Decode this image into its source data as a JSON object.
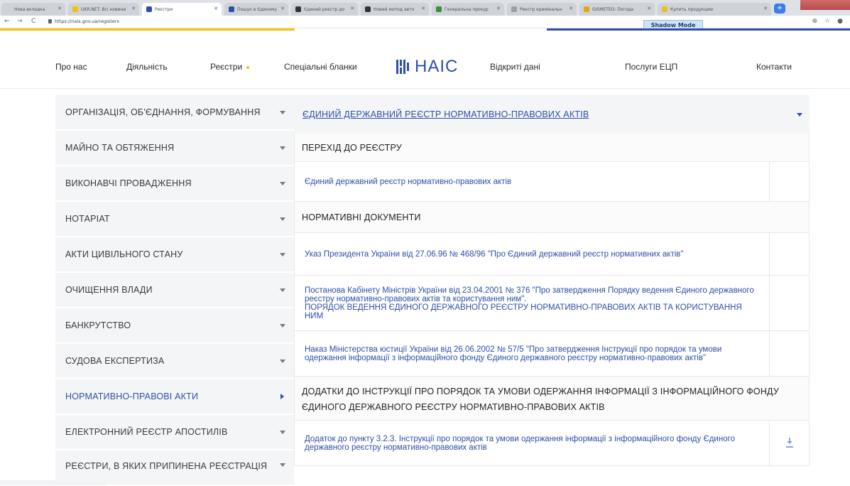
{
  "browser": {
    "tabs": [
      {
        "label": "Нова вкладка",
        "favicon_color": "#cfd3d9"
      },
      {
        "label": "UKR.NET: Всі новини",
        "favicon_color": "#f3c10a"
      },
      {
        "label": "Реєстри",
        "favicon_color": "#2e4fa8"
      },
      {
        "label": "Пошук в Єдиному",
        "favicon_color": "#2e4fa8"
      },
      {
        "label": "Єдиний реєстр до",
        "favicon_color": "#333333"
      },
      {
        "label": "Новий метод авто",
        "favicon_color": "#333333"
      },
      {
        "label": "Генеральна прокур",
        "favicon_color": "#3a8f3a"
      },
      {
        "label": "Реєстр кримінальн",
        "favicon_color": "#9aa0a6"
      },
      {
        "label": "GISMETEO: Погода",
        "favicon_color": "#e8a21b"
      },
      {
        "label": "Купить продукцию",
        "favicon_color": "#e8c21b"
      }
    ],
    "url": "https://nais.gov.ua/registers",
    "shadow_mode": "Shadow Mode",
    "accent_yellow": "#f3c10a",
    "accent_blue": "#2e4fa8"
  },
  "header": {
    "nav_left": [
      "Про нас",
      "Діяльність",
      "Реєстри",
      "Спеціальні бланки"
    ],
    "logo_text": "НАІС",
    "nav_right": [
      "Відкриті дані",
      "Послуги ЕЦП",
      "Контакти"
    ]
  },
  "sidebar": {
    "items": [
      {
        "label": "ОРГАНІЗАЦІЯ, ОБ'ЄДНАННЯ, ФОРМУВАННЯ"
      },
      {
        "label": "МАЙНО ТА ОБТЯЖЕННЯ"
      },
      {
        "label": "ВИКОНАВЧІ ПРОВАДЖЕННЯ"
      },
      {
        "label": "НОТАРІАТ"
      },
      {
        "label": "АКТИ ЦИВІЛЬНОГО СТАНУ"
      },
      {
        "label": "ОЧИЩЕННЯ ВЛАДИ"
      },
      {
        "label": "БАНКРУТСТВО"
      },
      {
        "label": "СУДОВА ЕКСПЕРТИЗА"
      },
      {
        "label": "НОРМАТИВНО-ПРАВОВІ АКТИ",
        "active": true
      },
      {
        "label": "ЕЛЕКТРОННИЙ РЕЄСТР АПОСТИЛІВ"
      },
      {
        "label": "РЕЄСТРИ, В ЯКИХ ПРИПИНЕНА РЕЄСТРАЦІЯ"
      }
    ]
  },
  "content": {
    "title": "ЄДИНИЙ ДЕРЖАВНИЙ РЕЄСТР НОРМАТИВНО-ПРАВОВИХ АКТІВ",
    "sections": {
      "goto": "ПЕРЕХІД ДО РЕЄСТРУ",
      "goto_link": "Єдиний державний реєстр нормативно-правових актів",
      "docs": "НОРМАТИВНІ ДОКУМЕНТИ",
      "doc1": "Указ Президента України від 27.06.96 № 468/96 \"Про Єдиний державний реєстр нормативних актів\"",
      "doc2": "Постанова Кабінету Міністрів України від 23.04.2001 № 376 \"Про затвердження Порядку ведення Єдиного державного реєстру нормативно-правових актів та користування ним\".",
      "doc2b": "ПОРЯДОК ВЕДЕННЯ ЄДИНОГО ДЕРЖАВНОГО РЕЄСТРУ НОРМАТИВНО-ПРАВОВИХ АКТІВ ТА КОРИСТУВАННЯ НИМ",
      "doc3": "Наказ Міністерства юстиції України від 26.06.2002 № 57/5 \"Про затвердження Інструкції про порядок та умови одержання інформації з інформаційного фонду Єдиного державного реєстру нормативно-правових актів\"",
      "annex_head": "ДОДАТКИ ДО ІНСТРУКЦІЇ ПРО ПОРЯДОК ТА УМОВИ ОДЕРЖАННЯ ІНФОРМАЦІЇ З ІНФОРМАЦІЙНОГО ФОНДУ ЄДИНОГО ДЕРЖАВНОГО РЕЄСТРУ НОРМАТИВНО-ПРАВОВИХ АКТІВ",
      "annex_link": "Додаток до пункту 3.2.3. Інструкції про порядок та умови одержання інформації з інформаційного фонду Єдиного державного реєстру нормативно-правових актів"
    },
    "download_icon": "download-icon"
  }
}
